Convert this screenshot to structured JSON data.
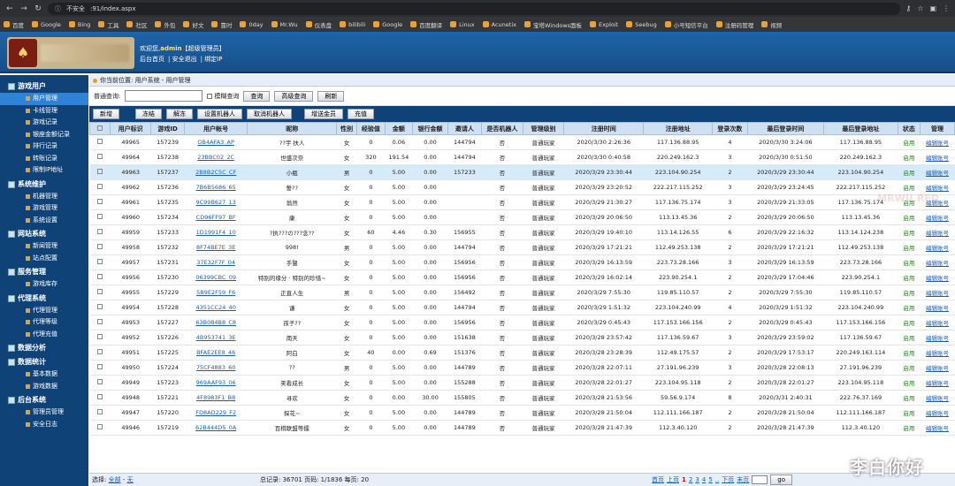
{
  "browser": {
    "security": "不安全",
    "url": ":91/index.aspx",
    "bookmarks": [
      "百度",
      "Google",
      "Bing",
      "工具",
      "社区",
      "外包",
      "好文",
      "靠时",
      "0day",
      "Mr.Wu",
      "仪表盘",
      "bilibili",
      "Google",
      "百度翻译",
      "Linux",
      "Acunetix",
      "宝塔Windows面板",
      "Exploit",
      "Seebug",
      "小号短信平台",
      "注册码管理",
      "视频"
    ]
  },
  "header": {
    "welcome_prefix": "欢迎您,",
    "admin": "admin",
    "role": "【超级管理员】",
    "links": [
      "后台首页",
      "安全退出",
      "绑定IP"
    ]
  },
  "sidebar": [
    {
      "group": "游戏用户",
      "items": [
        "用户管理",
        "卡线管理",
        "游戏记录",
        "银座金额记录",
        "排行记录",
        "转账记录",
        "限制IP地址"
      ]
    },
    {
      "group": "系统维护",
      "items": [
        "机器管理",
        "游戏管理",
        "系统设置"
      ]
    },
    {
      "group": "网站系统",
      "items": [
        "新闻管理",
        "站点配置"
      ]
    },
    {
      "group": "服务管理",
      "items": [
        "游戏库存"
      ]
    },
    {
      "group": "代理系统",
      "items": [
        "代理管理",
        "代理等级",
        "代理充值"
      ]
    },
    {
      "group": "数据分析",
      "items": []
    },
    {
      "group": "数据统计",
      "items": [
        "基本数据",
        "游戏数据"
      ]
    },
    {
      "group": "后台系统",
      "items": [
        "管理员管理",
        "安全日志"
      ]
    }
  ],
  "crumb": "你当前位置: 用户系统 - 用户管理",
  "search": {
    "label": "普通查询:",
    "value": "",
    "fuzzy": "模糊查询",
    "buttons": [
      "查询",
      "高级查询",
      "刷新"
    ]
  },
  "toolbar": [
    "新增",
    "冻结",
    "解冻",
    "设置机器人",
    "取消机器人",
    "增送金员",
    "充值"
  ],
  "columns": [
    "",
    "用户标识",
    "游戏ID",
    "用户帐号",
    "昵称",
    "性别",
    "经验值",
    "金额",
    "银行金额",
    "邀请人",
    "是否机器人",
    "管理级别",
    "注册时间",
    "注册地址",
    "登录次数",
    "最后登录时间",
    "最后登录地址",
    "状态",
    "管理"
  ],
  "rows": [
    [
      "49965",
      "157239",
      "OB4AFA3_AP",
      "??宇 扶人",
      "女",
      "0",
      "0.06",
      "0.00",
      "144794",
      "否",
      "普通玩家",
      "2020/3/30 2:26:36",
      "117.136.88.95",
      "4",
      "2020/3/30 3:24:06",
      "117.136.88.95",
      "启用",
      "编辑账号"
    ],
    [
      "49964",
      "157238",
      "23BBC02_2C",
      "世盛次奈",
      "女",
      "320",
      "191.54",
      "0.00",
      "144794",
      "否",
      "普通玩家",
      "2020/3/30 0:40:58",
      "220.249.162.3",
      "3",
      "2020/3/30 0:51:50",
      "220.249.162.3",
      "启用",
      "编辑账号"
    ],
    [
      "49963",
      "157237",
      "2B8B2C5C_CF",
      "小瓶",
      "男",
      "0",
      "5.00",
      "0.00",
      "157233",
      "否",
      "普通玩家",
      "2020/3/29 23:30:44",
      "223.104.90.254",
      "2",
      "2020/3/29 23:30:44",
      "223.104.90.254",
      "启用",
      "编辑账号"
    ],
    [
      "49962",
      "157236",
      "7B6B5686_65",
      "誓??",
      "女",
      "0",
      "5.00",
      "0.00",
      "",
      "否",
      "普通玩家",
      "2020/3/29 23:20:52",
      "222.217.115.252",
      "3",
      "2020/3/29 23:24:45",
      "222.217.115.252",
      "启用",
      "编辑账号"
    ],
    [
      "49961",
      "157235",
      "9C99B627_13",
      "翁然",
      "女",
      "0",
      "5.00",
      "0.00",
      "",
      "否",
      "普通玩家",
      "2020/3/29 21:30:27",
      "117.136.75.174",
      "3",
      "2020/3/29 21:33:05",
      "117.136.75.174",
      "启用",
      "编辑账号"
    ],
    [
      "49960",
      "157234",
      "CD96FF97_BF",
      "康",
      "女",
      "0",
      "5.00",
      "0.00",
      "",
      "否",
      "普通玩家",
      "2020/3/29 20:06:50",
      "113.13.45.36",
      "2",
      "2020/3/29 20:06:50",
      "113.13.45.36",
      "启用",
      "编辑账号"
    ],
    [
      "49959",
      "157233",
      "1D1991F4_10",
      "?执???の???念??",
      "女",
      "60",
      "4.46",
      "0.30",
      "156955",
      "否",
      "普通玩家",
      "2020/3/29 19:40:10",
      "113.14.126.55",
      "6",
      "2020/3/29 22:16:32",
      "113.14.124.238",
      "启用",
      "编辑账号"
    ],
    [
      "49958",
      "157232",
      "8F74BE7E_3E",
      "998!",
      "男",
      "0",
      "5.00",
      "0.00",
      "144794",
      "否",
      "普通玩家",
      "2020/3/29 17:21:21",
      "112.49.253.138",
      "2",
      "2020/3/29 17:21:21",
      "112.49.253.138",
      "启用",
      "编辑账号"
    ],
    [
      "49957",
      "157231",
      "37E32F7F_04",
      "手豎",
      "女",
      "0",
      "5.00",
      "0.00",
      "156956",
      "否",
      "普通玩家",
      "2020/3/29 16:13:59",
      "223.73.28.166",
      "3",
      "2020/3/29 16:13:59",
      "223.73.28.166",
      "启用",
      "编辑账号"
    ],
    [
      "49956",
      "157230",
      "06399CBC_09",
      "特别的缘分 · 特别的珍惜~",
      "女",
      "0",
      "5.00",
      "0.00",
      "156956",
      "否",
      "普通玩家",
      "2020/3/29 16:02:14",
      "223.90.254.1",
      "2",
      "2020/3/29 17:04:46",
      "223.90.254.1",
      "启用",
      "编辑账号"
    ],
    [
      "49955",
      "157229",
      "5B9E2F59_F6",
      "正直人生",
      "男",
      "0",
      "5.00",
      "0.00",
      "156492",
      "否",
      "普通玩家",
      "2020/3/29 7:55:30",
      "119.85.110.57",
      "2",
      "2020/3/29 7:55:30",
      "119.85.110.57",
      "启用",
      "编辑账号"
    ],
    [
      "49954",
      "157228",
      "4351CC24_40",
      "谦",
      "女",
      "0",
      "5.00",
      "0.00",
      "144794",
      "否",
      "普通玩家",
      "2020/3/29 1:51:32",
      "223.104.240.99",
      "4",
      "2020/3/29 1:51:32",
      "223.104.240.99",
      "启用",
      "编辑账号"
    ],
    [
      "49953",
      "157227",
      "63B084B8_C8",
      "孩子??",
      "女",
      "0",
      "5.00",
      "0.00",
      "156956",
      "否",
      "普通玩家",
      "2020/3/29 0:45:43",
      "117.153.166.156",
      "2",
      "2020/3/29 0:45:43",
      "117.153.166.156",
      "启用",
      "编辑账号"
    ],
    [
      "49952",
      "157226",
      "4B953741_3E",
      "南天",
      "女",
      "0",
      "5.00",
      "0.00",
      "151638",
      "否",
      "普通玩家",
      "2020/3/28 23:57:42",
      "117.136.59.67",
      "3",
      "2020/3/29 23:59:02",
      "117.136.59.67",
      "启用",
      "编辑账号"
    ],
    [
      "49951",
      "157225",
      "BFAE2EE8_46",
      "阿白",
      "女",
      "40",
      "0.00",
      "0.69",
      "151376",
      "否",
      "普通玩家",
      "2020/3/28 23:28:39",
      "112.49.175.57",
      "2",
      "2020/3/29 17:53:17",
      "220.249.163.114",
      "启用",
      "编辑账号"
    ],
    [
      "49950",
      "157224",
      "75CF4883_60",
      "??",
      "男",
      "0",
      "5.00",
      "0.00",
      "144789",
      "否",
      "普通玩家",
      "2020/3/28 22:07:11",
      "27.191.96.239",
      "3",
      "2020/3/28 22:08:13",
      "27.191.96.239",
      "启用",
      "编辑账号"
    ],
    [
      "49949",
      "157223",
      "969AAF93_06",
      "笑看成长",
      "女",
      "0",
      "5.00",
      "0.00",
      "155288",
      "否",
      "普通玩家",
      "2020/3/28 22:01:27",
      "223.104.95.118",
      "2",
      "2020/3/28 22:01:27",
      "223.104.95.118",
      "启用",
      "编辑账号"
    ],
    [
      "49948",
      "157221",
      "4F8983F1_B8",
      "寻欢",
      "女",
      "0",
      "0.00",
      "30.00",
      "155805",
      "否",
      "普通玩家",
      "2020/3/28 21:53:56",
      "59.56.9.174",
      "8",
      "2020/3/31 2:40:31",
      "222.76.37.169",
      "启用",
      "编辑账号"
    ],
    [
      "49947",
      "157220",
      "FD8AD229_F2",
      "探花~",
      "女",
      "0",
      "5.00",
      "0.00",
      "144789",
      "否",
      "普通玩家",
      "2020/3/28 21:50:04",
      "112.111.166.187",
      "2",
      "2020/3/28 21:50:04",
      "112.111.166.187",
      "启用",
      "编辑账号"
    ],
    [
      "49946",
      "157219",
      "62B444D5_0A",
      "百棋联盟等擂",
      "女",
      "0",
      "5.00",
      "0.00",
      "144789",
      "否",
      "普通玩家",
      "2020/3/28 21:47:39",
      "112.3.40.120",
      "2",
      "2020/3/28 21:47:39",
      "112.3.40.120",
      "启用",
      "编辑账号"
    ]
  ],
  "highlight_row": 2,
  "footer": {
    "select_label": "选择:",
    "select_all": "全部",
    "dash": "-",
    "select_none": "无",
    "total": "总记录: 36701",
    "pages": "页码: 1/1836",
    "per_page": "每页: 20",
    "pager": [
      "首页",
      "上页",
      "1",
      "2",
      "3",
      "4",
      "5",
      "..",
      "下页",
      "末页"
    ],
    "current_page": "1",
    "go": "go"
  },
  "watermark": "李白你好",
  "watermark2": "MRWU.RED",
  "colors": {
    "sidebar": "#0f4277",
    "header": "#1e64a8",
    "header_cell": "#cfe0f2",
    "active_menu": "#2f83d6",
    "highlight_row": "#d7eaf8",
    "status_on": "#1a8a1a"
  }
}
